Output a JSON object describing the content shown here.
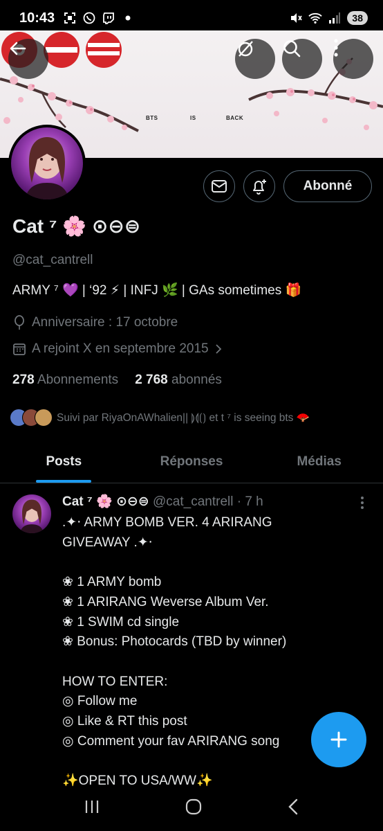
{
  "status_bar": {
    "time": "10:43",
    "battery": "38"
  },
  "banner": {
    "label_1": "BTS",
    "label_2": "IS",
    "label_3": "BACK"
  },
  "profile": {
    "name": "Cat ⁷ 🌸 ⊙⊖⊜",
    "handle": "@cat_cantrell",
    "bio": "ARMY ⁷ 💜 | ‘92 ⚡ | INFJ 🌿 | GAs sometimes 🎁",
    "birthday": "Anniversaire : 17 octobre",
    "joined": "A rejoint X en septembre 2015",
    "following_count": "278",
    "following_label": "Abonnements",
    "followers_count": "2 768",
    "followers_label": "abonnés",
    "followed_by": "Suivi par RiyaOnAWhalien|| ⟭⟬⟮⟯ et t ⁷ is seeing bts 🪭",
    "follow_button": "Abonné"
  },
  "tabs": [
    {
      "label": "Posts",
      "active": true
    },
    {
      "label": "Réponses",
      "active": false
    },
    {
      "label": "Médias",
      "active": false
    }
  ],
  "post": {
    "name": "Cat ⁷ 🌸 ⊙⊖⊜",
    "handle_time": "@cat_cantrell · 7 h",
    "body": ".✦⋅ ARMY BOMB VER. 4 ARIRANG\nGIVEAWAY .✦⋅\n\n❀ 1 ARMY bomb\n❀ 1 ARIRANG Weverse Album Ver.\n❀ 1 SWIM cd single\n❀ Bonus: Photocards (TBD by winner)\n\nHOW TO ENTER:\n◎ Follow me\n◎ Like & RT this post\n◎ Comment your fav ARIRANG song\n\n✨OPEN TO USA/WW✨"
  },
  "colors": {
    "accent": "#1d9bf0",
    "background": "#000000",
    "muted": "#71767b",
    "text": "#e7e9ea",
    "logo_red": "#d6262b"
  }
}
